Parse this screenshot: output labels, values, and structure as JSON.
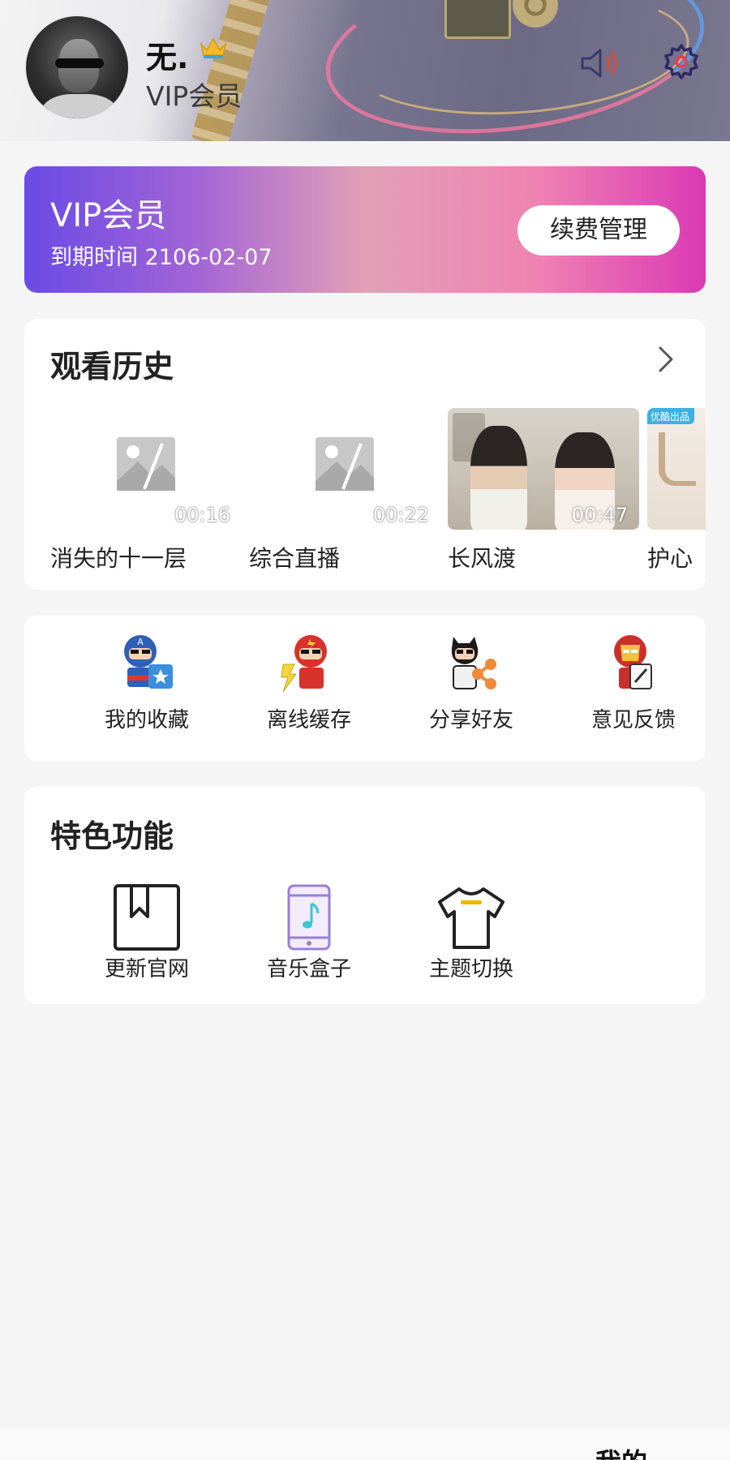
{
  "header": {
    "user_name": "无.",
    "user_level": "VIP会员",
    "icons": {
      "crown": "crown-icon",
      "speaker": "speaker-icon",
      "settings": "gear-icon"
    }
  },
  "vip": {
    "title": "VIP会员",
    "expire": "到期时间 2106-02-07",
    "renew_label": "续费管理"
  },
  "history": {
    "title": "观看历史",
    "items": [
      {
        "name": "消失的十一层",
        "time": "00:16",
        "thumb": "placeholder"
      },
      {
        "name": "综合直播",
        "time": "00:22",
        "thumb": "placeholder"
      },
      {
        "name": "长风渡",
        "time": "00:47",
        "thumb": "drama-poster"
      },
      {
        "name": "护心",
        "time": "",
        "thumb": "promo-poster",
        "tag": "优酷出品"
      }
    ]
  },
  "actions": [
    {
      "label": "我的收藏",
      "icon": "captain-folder-icon"
    },
    {
      "label": "离线缓存",
      "icon": "flash-hero-icon"
    },
    {
      "label": "分享好友",
      "icon": "share-hero-icon"
    },
    {
      "label": "意见反馈",
      "icon": "ironman-feedback-icon"
    }
  ],
  "features": {
    "title": "特色功能",
    "items": [
      {
        "label": "更新官网",
        "icon": "bookmark-icon"
      },
      {
        "label": "音乐盒子",
        "icon": "music-phone-icon"
      },
      {
        "label": "主题切换",
        "icon": "tshirt-icon"
      }
    ]
  },
  "bottom_nav": {
    "mine_label": "我的"
  },
  "colors": {
    "vip_gradient_start": "#6a4be6",
    "vip_gradient_end": "#db39b4",
    "page_bg": "#f5f5f5"
  }
}
